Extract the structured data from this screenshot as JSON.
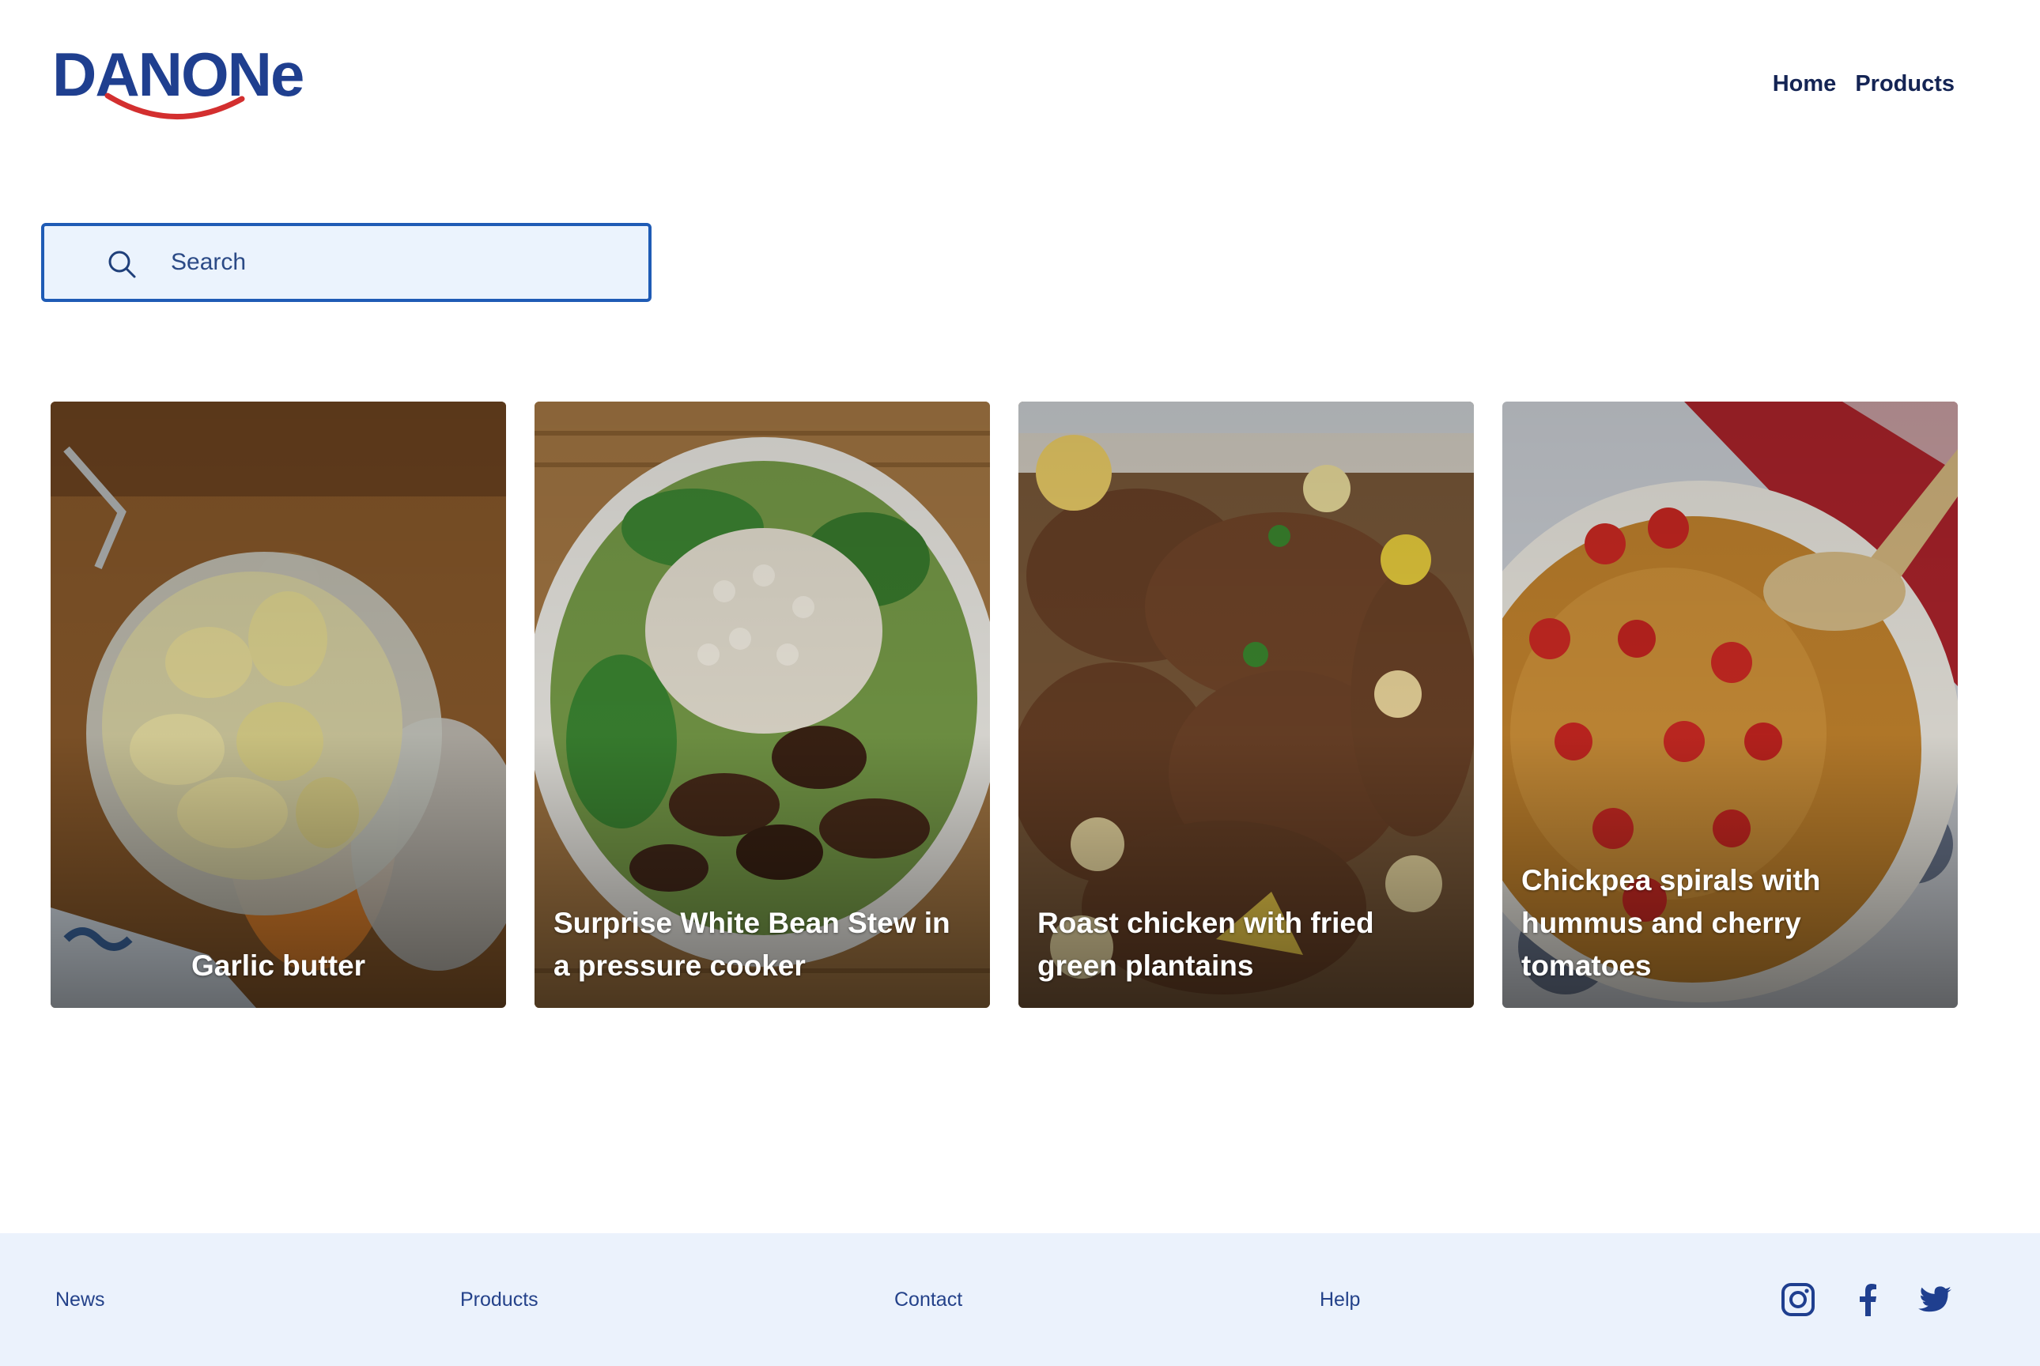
{
  "brand": {
    "logo_text": "DANONe",
    "logo_color": "#1f3f8f",
    "smile_color": "#d32f2f"
  },
  "nav": {
    "items": [
      "Home",
      "Products"
    ]
  },
  "search": {
    "placeholder": "Search",
    "value": "",
    "icon": "search-icon"
  },
  "recipes": [
    {
      "title": "Garlic butter",
      "image": "garlic-butter-jar"
    },
    {
      "title": "Surprise White Bean Stew in a pressure cooker",
      "image": "white-bean-stew-bowl"
    },
    {
      "title": "Roast chicken with fried green plantains",
      "image": "roast-chicken-tray"
    },
    {
      "title": "Chickpea spirals with hummus and cherry tomatoes",
      "image": "chickpea-spirals-bowl"
    }
  ],
  "footer": {
    "links": [
      "News",
      "Products",
      "Contact",
      "Help"
    ],
    "social": [
      "instagram-icon",
      "facebook-icon",
      "twitter-icon"
    ]
  },
  "colors": {
    "accent": "#1f5bb5",
    "nav_text": "#142454",
    "footer_bg": "#ebf2fc",
    "search_bg": "#ebf3fd"
  }
}
